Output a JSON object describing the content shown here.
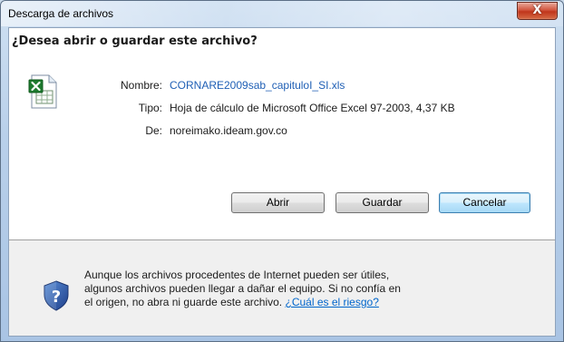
{
  "window": {
    "title": "Descarga de archivos",
    "close_label": "X"
  },
  "dialog": {
    "question": "¿Desea abrir o guardar este archivo?",
    "file_icon": "excel-file-icon",
    "name_label": "Nombre:",
    "name_value": "CORNARE2009sab_capituloI_SI.xls",
    "type_label": "Tipo:",
    "type_value": "Hoja de cálculo de Microsoft Office Excel 97-2003, 4,37 KB",
    "from_label": "De:",
    "from_value": "noreimako.ideam.gov.co"
  },
  "buttons": {
    "open": "Abrir",
    "save": "Guardar",
    "cancel": "Cancelar"
  },
  "warning": {
    "icon": "shield-question-icon",
    "line1": "Aunque los archivos procedentes de Internet pueden ser útiles,",
    "line2": "algunos archivos pueden llegar a dañar el equipo. Si no confía en",
    "line3": "el origen, no abra ni guarde este archivo.",
    "link": "¿Cuál es el riesgo?"
  },
  "colors": {
    "link": "#1f5fb5",
    "default_button_border": "#3c7fb1",
    "close_button": "#c0351b"
  }
}
